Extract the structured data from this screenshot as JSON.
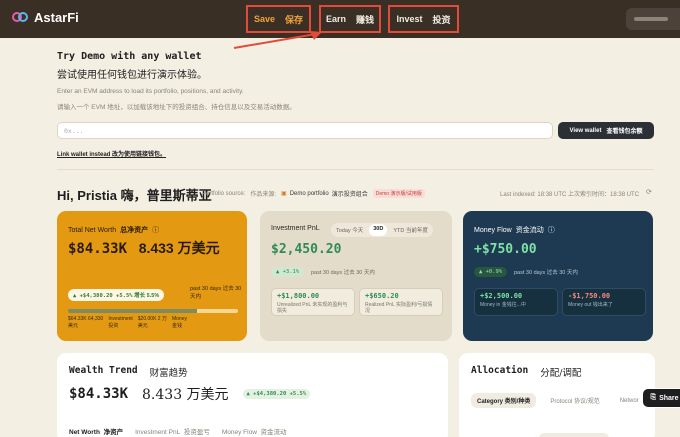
{
  "brand": {
    "name": "AstarFi"
  },
  "nav": [
    {
      "en": "Save",
      "cn": "保存"
    },
    {
      "en": "Earn",
      "cn": "赚钱"
    },
    {
      "en": "Invest",
      "cn": "投资"
    }
  ],
  "demo": {
    "title": "Try Demo with any wallet",
    "title_cn": "尝试使用任何钱包进行演示体验。",
    "desc": "Enter an EVM address to load its portfolio, positions, and activity.",
    "desc_cn": "请输入一个 EVM 地址，以加载该地址下的投资组合、持仓信息以及交易活动数据。",
    "placeholder": "0x...",
    "view_btn": "View wallet",
    "view_btn_cn": "查看钱包余额",
    "link_wallet": "Link wallet instead",
    "link_wallet_cn": "改为使用链接钱包。"
  },
  "greeting": {
    "text": "Hi, Pristia 嗨，普里斯蒂亚",
    "source_label": "Portfolio source:",
    "source_label_cn": "作品来源:",
    "source_value": "Demo portfolio",
    "source_value_cn": "演示投资组合",
    "badge": "Demo 演示版/试用版",
    "indexed": "Last indexed: 18:38 UTC",
    "indexed_cn": "上次索引时间：18:38 UTC"
  },
  "net_worth": {
    "label": "Total Net Worth",
    "label_cn": "总净资产",
    "value": "$84.33K",
    "value_cn": "8.433 万美元",
    "change": "▲ +$4,380.20 +5.5%",
    "change_cn": "增长 5.5%",
    "period": "past 30 days 过去 30 天内",
    "legend": [
      {
        "line1": "$64.33K 64,330",
        "line2": "美元"
      },
      {
        "line1": "Investment",
        "line2": "投资"
      },
      {
        "line1": "$20.00K 2 万",
        "line2": "美元"
      },
      {
        "line1": "Money",
        "line2": "金钱"
      }
    ],
    "split": [
      0.76,
      0.24
    ]
  },
  "pnl": {
    "label": "Investment PnL",
    "tabs": [
      "Today 今天",
      "30D",
      "YTD 当前年度"
    ],
    "active_tab": 1,
    "value": "$2,450.20",
    "change": "▲ +3.1%",
    "period": "past 30 days 过去 30 天内",
    "unrealized": {
      "value": "+$1,800.00",
      "label": "Unrealized PnL",
      "label_cn": "未实现的盈利与损失"
    },
    "realized": {
      "value": "+$650.20",
      "label": "Realized PnL",
      "label_cn": "实际盈利/亏损情况"
    }
  },
  "flow": {
    "label": "Money Flow",
    "label_cn": "资金流动",
    "value": "+$750.00",
    "change": "▲ +0.9%",
    "period": "past 30 days 过去 30 天内",
    "in": {
      "value": "+$2,500.00",
      "label": "Money in",
      "label_cn": "金钱往...中"
    },
    "out": {
      "value": "-$1,750.00",
      "label": "Money out",
      "label_cn": "钱出来了"
    }
  },
  "wealth": {
    "title": "Wealth Trend",
    "title_cn": "财富趋势",
    "value": "$84.33K",
    "value_cn": "8.433 万美元",
    "change": "▲ +$4,380.20 +5.5%",
    "tabs": [
      {
        "en": "Net Worth",
        "cn": "净资产"
      },
      {
        "en": "Investment PnL",
        "cn": "投资盈亏"
      },
      {
        "en": "Money Flow",
        "cn": "资金流动"
      }
    ]
  },
  "allocation": {
    "title": "Allocation",
    "title_cn": "分配/调配",
    "tabs": [
      "Category 类别/种类",
      "Protocol 协议/规范",
      "Networ"
    ]
  },
  "share": {
    "label": "Share"
  },
  "colors": {
    "accent": "#e39a12",
    "nav_bg": "#3a2f25",
    "flow_bg": "#1e3a52",
    "positive": "#2e8b57",
    "highlight_border": "#e24b3b"
  }
}
